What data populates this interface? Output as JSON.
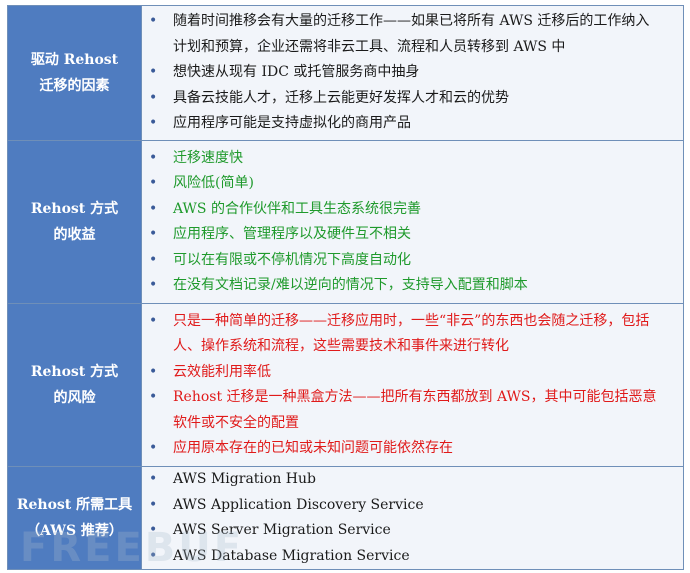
{
  "rows": [
    {
      "header": [
        "驱动 Rehost",
        "迁移的因素"
      ],
      "color": "black",
      "items": [
        "随着时间推移会有大量的迁移工作——如果已将所有 AWS 迁移后的工作纳入计划和预算，企业还需将非云工具、流程和人员转移到 AWS 中",
        "想快速从现有 IDC 或托管服务商中抽身",
        "具备云技能人才，迁移上云能更好发挥人才和云的优势",
        "应用程序可能是支持虚拟化的商用产品"
      ]
    },
    {
      "header": [
        "Rehost 方式",
        "的收益"
      ],
      "color": "green",
      "items": [
        "迁移速度快",
        "风险低(简单)",
        "AWS 的合作伙伴和工具生态系统很完善",
        "应用程序、管理程序以及硬件互不相关",
        "可以在有限或不停机情况下高度自动化",
        "在没有文档记录/难以逆向的情况下，支持导入配置和脚本"
      ]
    },
    {
      "header": [
        "Rehost 方式",
        "的风险"
      ],
      "color": "red",
      "items": [
        "只是一种简单的迁移——迁移应用时，一些“非云”的东西也会随之迁移，包括人、操作系统和流程，这些需要技术和事件来进行转化",
        "云效能利用率低",
        "Rehost 迁移是一种黑盒方法——把所有东西都放到 AWS，其中可能包括恶意软件或不安全的配置",
        "应用原本存在的已知或未知问题可能依然存在"
      ]
    },
    {
      "header": [
        "Rehost 所需工具",
        "（AWS 推荐）"
      ],
      "color": "black",
      "items": [
        "AWS Migration Hub",
        "AWS Application Discovery Service",
        "AWS Server Migration Service",
        "AWS Database Migration Service"
      ]
    }
  ],
  "bullet": "•",
  "colors": {
    "header_bg": "#4f7cc0",
    "body_bg": "#f2f5fa",
    "border": "#6f8fb8",
    "black": "#1a1a1a",
    "green": "#1f9a2c",
    "red": "#e01a1a"
  },
  "watermark": "FREEBUF"
}
